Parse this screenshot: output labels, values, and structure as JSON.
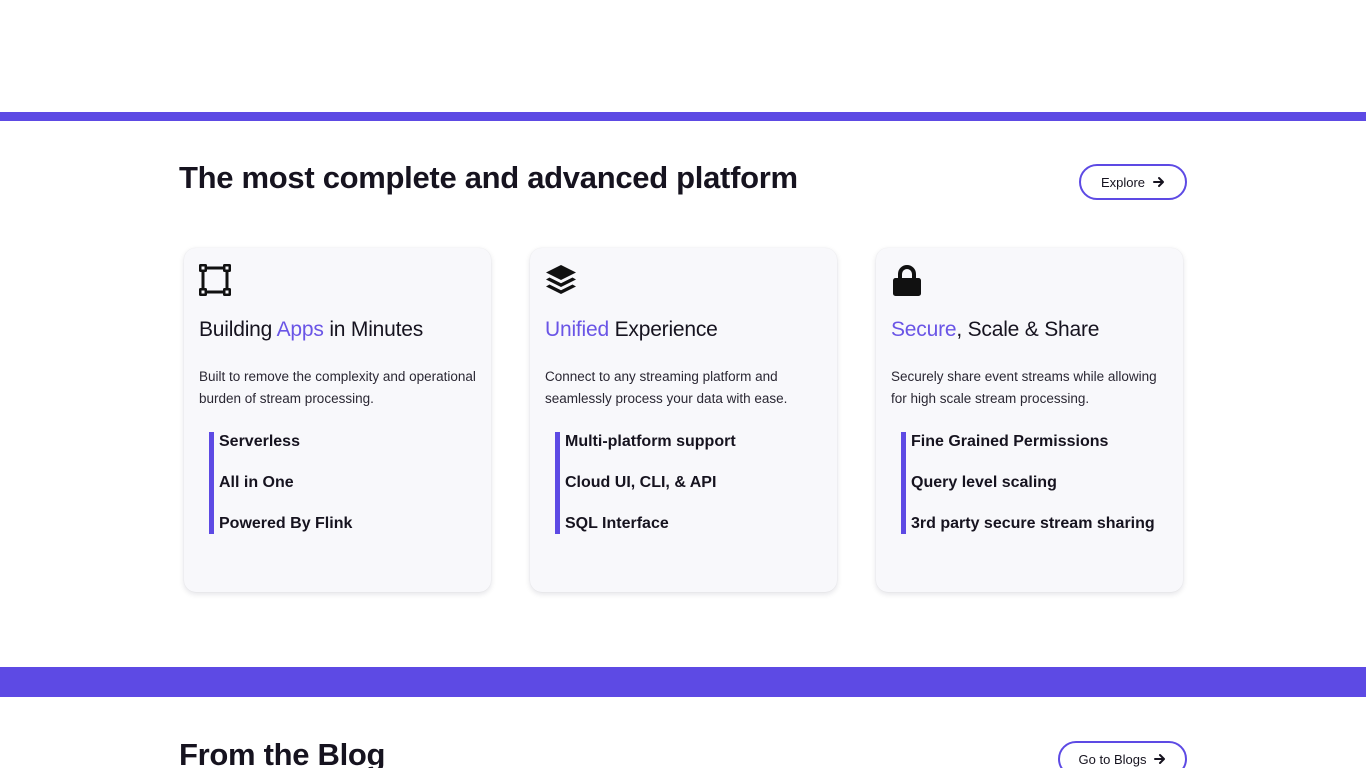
{
  "colors": {
    "accent": "#5d4ae4",
    "highlight": "#6a55e6",
    "text": "#16131f",
    "card_bg": "#f8f8fb"
  },
  "platform": {
    "title": "The most complete and advanced platform",
    "explore_label": "Explore",
    "cards": [
      {
        "icon": "vector-square-icon",
        "title_pre": "Building ",
        "title_hl": "Apps",
        "title_post": " in Minutes",
        "description": "Built to remove the complexity and operational burden of stream processing.",
        "features": [
          "Serverless",
          "All in One",
          "Powered By Flink"
        ]
      },
      {
        "icon": "layer-group-icon",
        "title_pre": "",
        "title_hl": "Unified",
        "title_post": " Experience",
        "description": "Connect to any streaming platform and seamlessly process your data with ease.",
        "features": [
          "Multi-platform support",
          "Cloud UI, CLI, & API",
          "SQL Interface"
        ]
      },
      {
        "icon": "lock-icon",
        "title_pre": "",
        "title_hl": "Secure",
        "title_post": ", Scale & Share",
        "description": "Securely share event streams while allowing for high scale stream processing.",
        "features": [
          "Fine Grained Permissions",
          "Query level scaling",
          "3rd party secure stream sharing"
        ]
      }
    ]
  },
  "blog": {
    "title": "From the Blog",
    "go_label": "Go to Blogs"
  }
}
